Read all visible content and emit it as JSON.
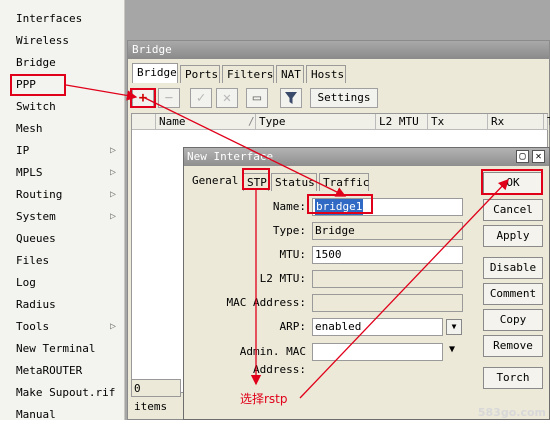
{
  "sidebar": {
    "items": [
      {
        "label": "Interfaces",
        "submenu": false
      },
      {
        "label": "Wireless",
        "submenu": false
      },
      {
        "label": "Bridge",
        "submenu": false
      },
      {
        "label": "PPP",
        "submenu": false
      },
      {
        "label": "Switch",
        "submenu": false
      },
      {
        "label": "Mesh",
        "submenu": false
      },
      {
        "label": "IP",
        "submenu": true
      },
      {
        "label": "MPLS",
        "submenu": true
      },
      {
        "label": "Routing",
        "submenu": true
      },
      {
        "label": "System",
        "submenu": true
      },
      {
        "label": "Queues",
        "submenu": false
      },
      {
        "label": "Files",
        "submenu": false
      },
      {
        "label": "Log",
        "submenu": false
      },
      {
        "label": "Radius",
        "submenu": false
      },
      {
        "label": "Tools",
        "submenu": true
      },
      {
        "label": "New Terminal",
        "submenu": false
      },
      {
        "label": "MetaROUTER",
        "submenu": false
      },
      {
        "label": "Make Supout.rif",
        "submenu": false
      },
      {
        "label": "Manual",
        "submenu": false
      }
    ],
    "submenu_arrow": "▷"
  },
  "bridge_window": {
    "title": "Bridge",
    "tabs": [
      "Bridge",
      "Ports",
      "Filters",
      "NAT",
      "Hosts"
    ],
    "toolbar": {
      "add": "+",
      "remove": "−",
      "enable": "✓",
      "disable": "✕",
      "comment": "▭",
      "settings_label": "Settings"
    },
    "columns": [
      "Name",
      "Type",
      "L2 MTU",
      "Tx",
      "Rx",
      "T"
    ],
    "sort_indicator": "/",
    "status": "0 items"
  },
  "dialog": {
    "title": "New Interface",
    "tabs": [
      "General",
      "STP",
      "Status",
      "Traffic"
    ],
    "fields": {
      "name": {
        "label": "Name:",
        "value": "bridge1"
      },
      "type": {
        "label": "Type:",
        "value": "Bridge"
      },
      "mtu": {
        "label": "MTU:",
        "value": "1500"
      },
      "l2mtu": {
        "label": "L2 MTU:",
        "value": ""
      },
      "mac": {
        "label": "MAC Address:",
        "value": ""
      },
      "arp": {
        "label": "ARP:",
        "value": "enabled"
      },
      "admin_mac": {
        "label": "Admin. MAC Address:",
        "value": ""
      }
    },
    "buttons": [
      "OK",
      "Cancel",
      "Apply",
      "Disable",
      "Comment",
      "Copy",
      "Remove",
      "Torch"
    ]
  },
  "annotation": {
    "text": "选择rstp",
    "color": "#e0001a"
  },
  "watermark": "583go.com"
}
